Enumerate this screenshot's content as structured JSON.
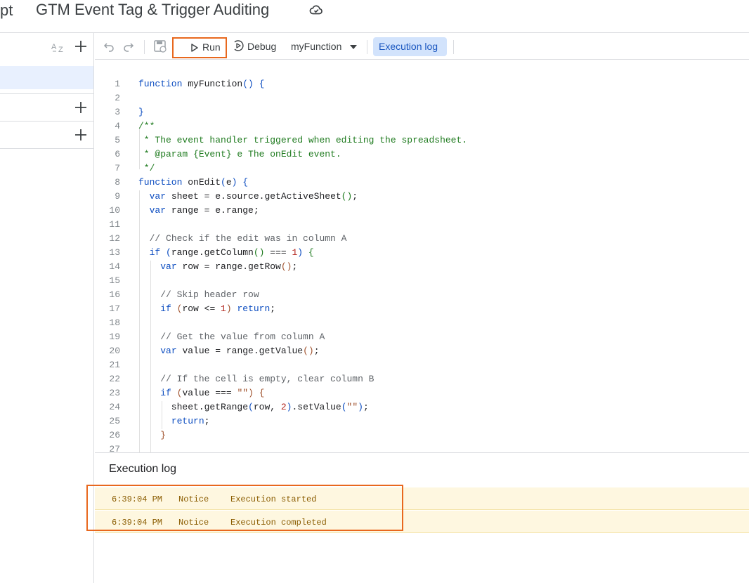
{
  "header": {
    "app_fragment": "pt",
    "project_title": "GTM Event Tag & Trigger Auditing",
    "cloud_icon": "cloud-saved-icon"
  },
  "left_panel": {
    "sort_icon": "sort-az-icon",
    "add_icon": "plus-icon"
  },
  "toolbar": {
    "run_label": "Run",
    "debug_label": "Debug",
    "function_selected": "myFunction",
    "execution_log_label": "Execution log",
    "highlight_color": "#e8681e"
  },
  "editor": {
    "lines": [
      {
        "n": "1",
        "tokens": [
          [
            "kw",
            "function "
          ],
          [
            "id",
            "myFunction"
          ],
          [
            "p2",
            "() {"
          ]
        ]
      },
      {
        "n": "2",
        "tokens": []
      },
      {
        "n": "3",
        "tokens": [
          [
            "p2",
            "}"
          ]
        ]
      },
      {
        "n": "4",
        "tokens": [
          [
            "cm",
            "/**"
          ]
        ]
      },
      {
        "n": "5",
        "tokens": [
          [
            "cm",
            " * The event handler triggered when editing the spreadsheet."
          ]
        ]
      },
      {
        "n": "6",
        "tokens": [
          [
            "cm",
            " * @param {Event} e The onEdit event."
          ]
        ]
      },
      {
        "n": "7",
        "tokens": [
          [
            "cm",
            " */"
          ]
        ]
      },
      {
        "n": "8",
        "tokens": [
          [
            "kw",
            "function "
          ],
          [
            "id",
            "onEdit"
          ],
          [
            "p2",
            "("
          ],
          [
            "id",
            "e"
          ],
          [
            "p2",
            ") {"
          ]
        ]
      },
      {
        "n": "9",
        "tokens": [
          [
            "id",
            "  "
          ],
          [
            "kw",
            "var "
          ],
          [
            "id",
            "sheet = e.source.getActiveSheet"
          ],
          [
            "p1",
            "()"
          ],
          [
            "id",
            ";"
          ]
        ]
      },
      {
        "n": "10",
        "tokens": [
          [
            "id",
            "  "
          ],
          [
            "kw",
            "var "
          ],
          [
            "id",
            "range = e.range;"
          ]
        ]
      },
      {
        "n": "11",
        "tokens": []
      },
      {
        "n": "12",
        "tokens": [
          [
            "id",
            "  "
          ],
          [
            "cg",
            "// Check if the edit was in column A"
          ]
        ]
      },
      {
        "n": "13",
        "tokens": [
          [
            "id",
            "  "
          ],
          [
            "kw",
            "if "
          ],
          [
            "p2",
            "("
          ],
          [
            "id",
            "range.getColumn"
          ],
          [
            "p1",
            "()"
          ],
          [
            "id",
            " === "
          ],
          [
            "nu",
            "1"
          ],
          [
            "p2",
            ") "
          ],
          [
            "p1",
            "{"
          ]
        ]
      },
      {
        "n": "14",
        "tokens": [
          [
            "id",
            "    "
          ],
          [
            "kw",
            "var "
          ],
          [
            "id",
            "row = range.getRow"
          ],
          [
            "st",
            "()"
          ],
          [
            "id",
            ";"
          ]
        ]
      },
      {
        "n": "15",
        "tokens": []
      },
      {
        "n": "16",
        "tokens": [
          [
            "id",
            "    "
          ],
          [
            "cg",
            "// Skip header row"
          ]
        ]
      },
      {
        "n": "17",
        "tokens": [
          [
            "id",
            "    "
          ],
          [
            "kw",
            "if "
          ],
          [
            "st",
            "("
          ],
          [
            "id",
            "row <= "
          ],
          [
            "nu",
            "1"
          ],
          [
            "st",
            ")"
          ],
          [
            "kw",
            " return"
          ],
          [
            "id",
            ";"
          ]
        ]
      },
      {
        "n": "18",
        "tokens": []
      },
      {
        "n": "19",
        "tokens": [
          [
            "id",
            "    "
          ],
          [
            "cg",
            "// Get the value from column A"
          ]
        ]
      },
      {
        "n": "20",
        "tokens": [
          [
            "id",
            "    "
          ],
          [
            "kw",
            "var "
          ],
          [
            "id",
            "value = range.getValue"
          ],
          [
            "st",
            "()"
          ],
          [
            "id",
            ";"
          ]
        ]
      },
      {
        "n": "21",
        "tokens": []
      },
      {
        "n": "22",
        "tokens": [
          [
            "id",
            "    "
          ],
          [
            "cg",
            "// If the cell is empty, clear column B"
          ]
        ]
      },
      {
        "n": "23",
        "tokens": [
          [
            "id",
            "    "
          ],
          [
            "kw",
            "if "
          ],
          [
            "st",
            "("
          ],
          [
            "id",
            "value === "
          ],
          [
            "st",
            "\"\""
          ],
          [
            "st",
            ") {"
          ]
        ]
      },
      {
        "n": "24",
        "tokens": [
          [
            "id",
            "      sheet.getRange"
          ],
          [
            "p2",
            "("
          ],
          [
            "id",
            "row, "
          ],
          [
            "nu",
            "2"
          ],
          [
            "p2",
            ")"
          ],
          [
            "id",
            ".setValue"
          ],
          [
            "p2",
            "("
          ],
          [
            "st",
            "\"\""
          ],
          [
            "p2",
            ")"
          ],
          [
            "id",
            ";"
          ]
        ]
      },
      {
        "n": "25",
        "tokens": [
          [
            "id",
            "      "
          ],
          [
            "kw",
            "return"
          ],
          [
            "id",
            ";"
          ]
        ]
      },
      {
        "n": "26",
        "tokens": [
          [
            "id",
            "    "
          ],
          [
            "st",
            "}"
          ]
        ]
      },
      {
        "n": "27",
        "tokens": []
      }
    ]
  },
  "execution_log": {
    "title": "Execution log",
    "rows": [
      {
        "time": "6:39:04 PM",
        "level": "Notice",
        "message": "Execution started"
      },
      {
        "time": "6:39:04 PM",
        "level": "Notice",
        "message": "Execution completed"
      }
    ]
  }
}
